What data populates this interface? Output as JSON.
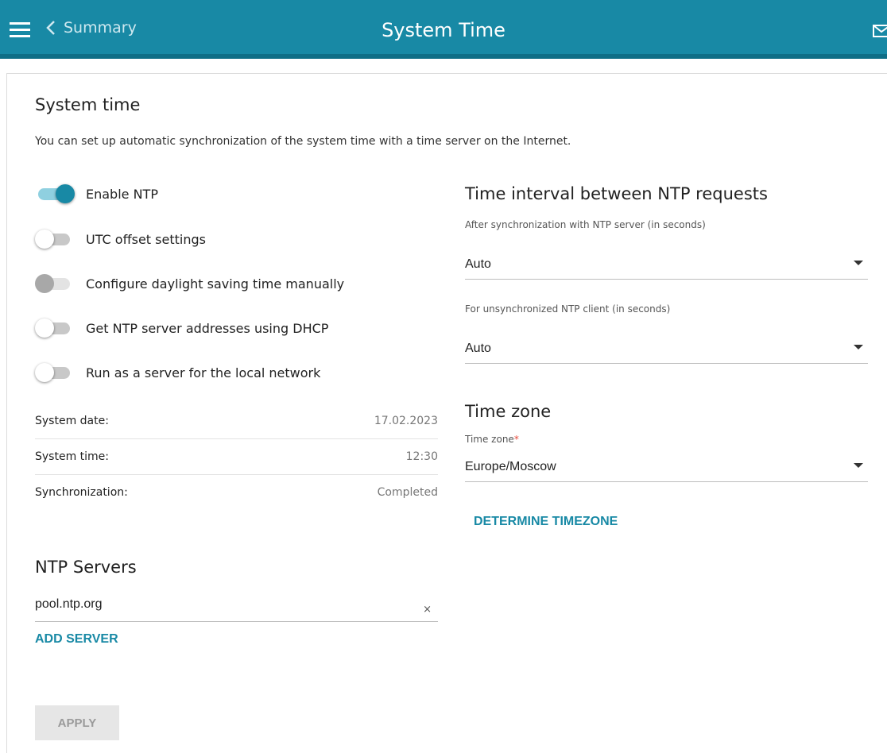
{
  "header": {
    "back_label": "Summary",
    "title": "System Time"
  },
  "system_time": {
    "title": "System time",
    "description": "You can set up automatic synchronization of the system time with a time server on the Internet."
  },
  "toggles": [
    {
      "label": "Enable NTP",
      "state": "on"
    },
    {
      "label": "UTC offset settings",
      "state": "off"
    },
    {
      "label": "Configure daylight saving time manually",
      "state": "disabled"
    },
    {
      "label": "Get NTP server addresses using DHCP",
      "state": "off"
    },
    {
      "label": "Run as a server for the local network",
      "state": "off"
    }
  ],
  "info": [
    {
      "label": "System date:",
      "value": "17.02.2023"
    },
    {
      "label": "System time:",
      "value": "12:30"
    },
    {
      "label": "Synchronization:",
      "value": "Completed"
    }
  ],
  "ntp_servers": {
    "title": "NTP Servers",
    "servers": [
      "pool.ntp.org"
    ],
    "clear_glyph": "×",
    "add_label": "ADD SERVER"
  },
  "interval": {
    "title": "Time interval between NTP requests",
    "after_sync_label": "After synchronization with NTP server (in seconds)",
    "after_sync_value": "Auto",
    "unsync_label": "For unsynchronized NTP client (in seconds)",
    "unsync_value": "Auto"
  },
  "timezone": {
    "title": "Time zone",
    "field_label": "Time zone",
    "required_mark": "*",
    "value": "Europe/Moscow",
    "determine_label": "DETERMINE TIMEZONE"
  },
  "apply_label": "APPLY",
  "colors": {
    "accent": "#1889a5",
    "header": "#1889a5"
  }
}
